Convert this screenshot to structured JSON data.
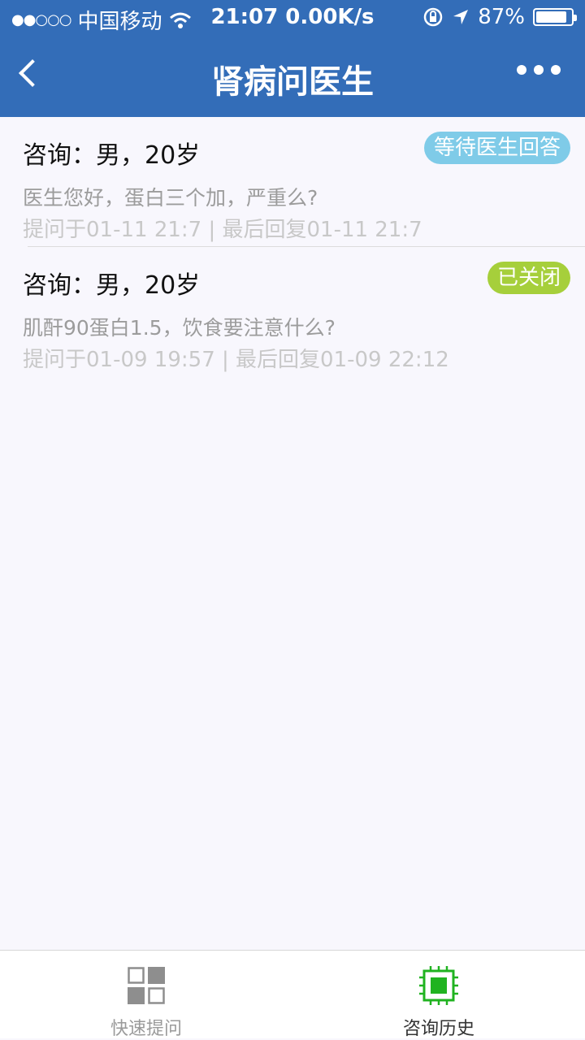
{
  "status_bar": {
    "carrier": "中国移动",
    "time_speed": "21:07 0.00K/s",
    "battery": "87%",
    "battery_level": 0.87
  },
  "nav": {
    "title": "肾病问医生"
  },
  "consultations": [
    {
      "heading": "咨询：男，20岁",
      "status": "等待医生回答",
      "status_color": "#7fcbe8",
      "question": "医生您好，蛋白三个加，严重么?",
      "meta": "提问于01-11 21:7 | 最后回复01-11 21:7"
    },
    {
      "heading": "咨询：男，20岁",
      "status": "已关闭",
      "status_color": "#a6cf3b",
      "question": "肌酐90蛋白1.5，饮食要注意什么?",
      "meta": "提问于01-09 19:57 | 最后回复01-09 22:12"
    }
  ],
  "tabs": [
    {
      "label": "快速提问",
      "icon": "grid-icon",
      "color": "#9a9a9a"
    },
    {
      "label": "咨询历史",
      "icon": "chip-icon",
      "color": "#333333",
      "accent": "#20b320"
    }
  ]
}
